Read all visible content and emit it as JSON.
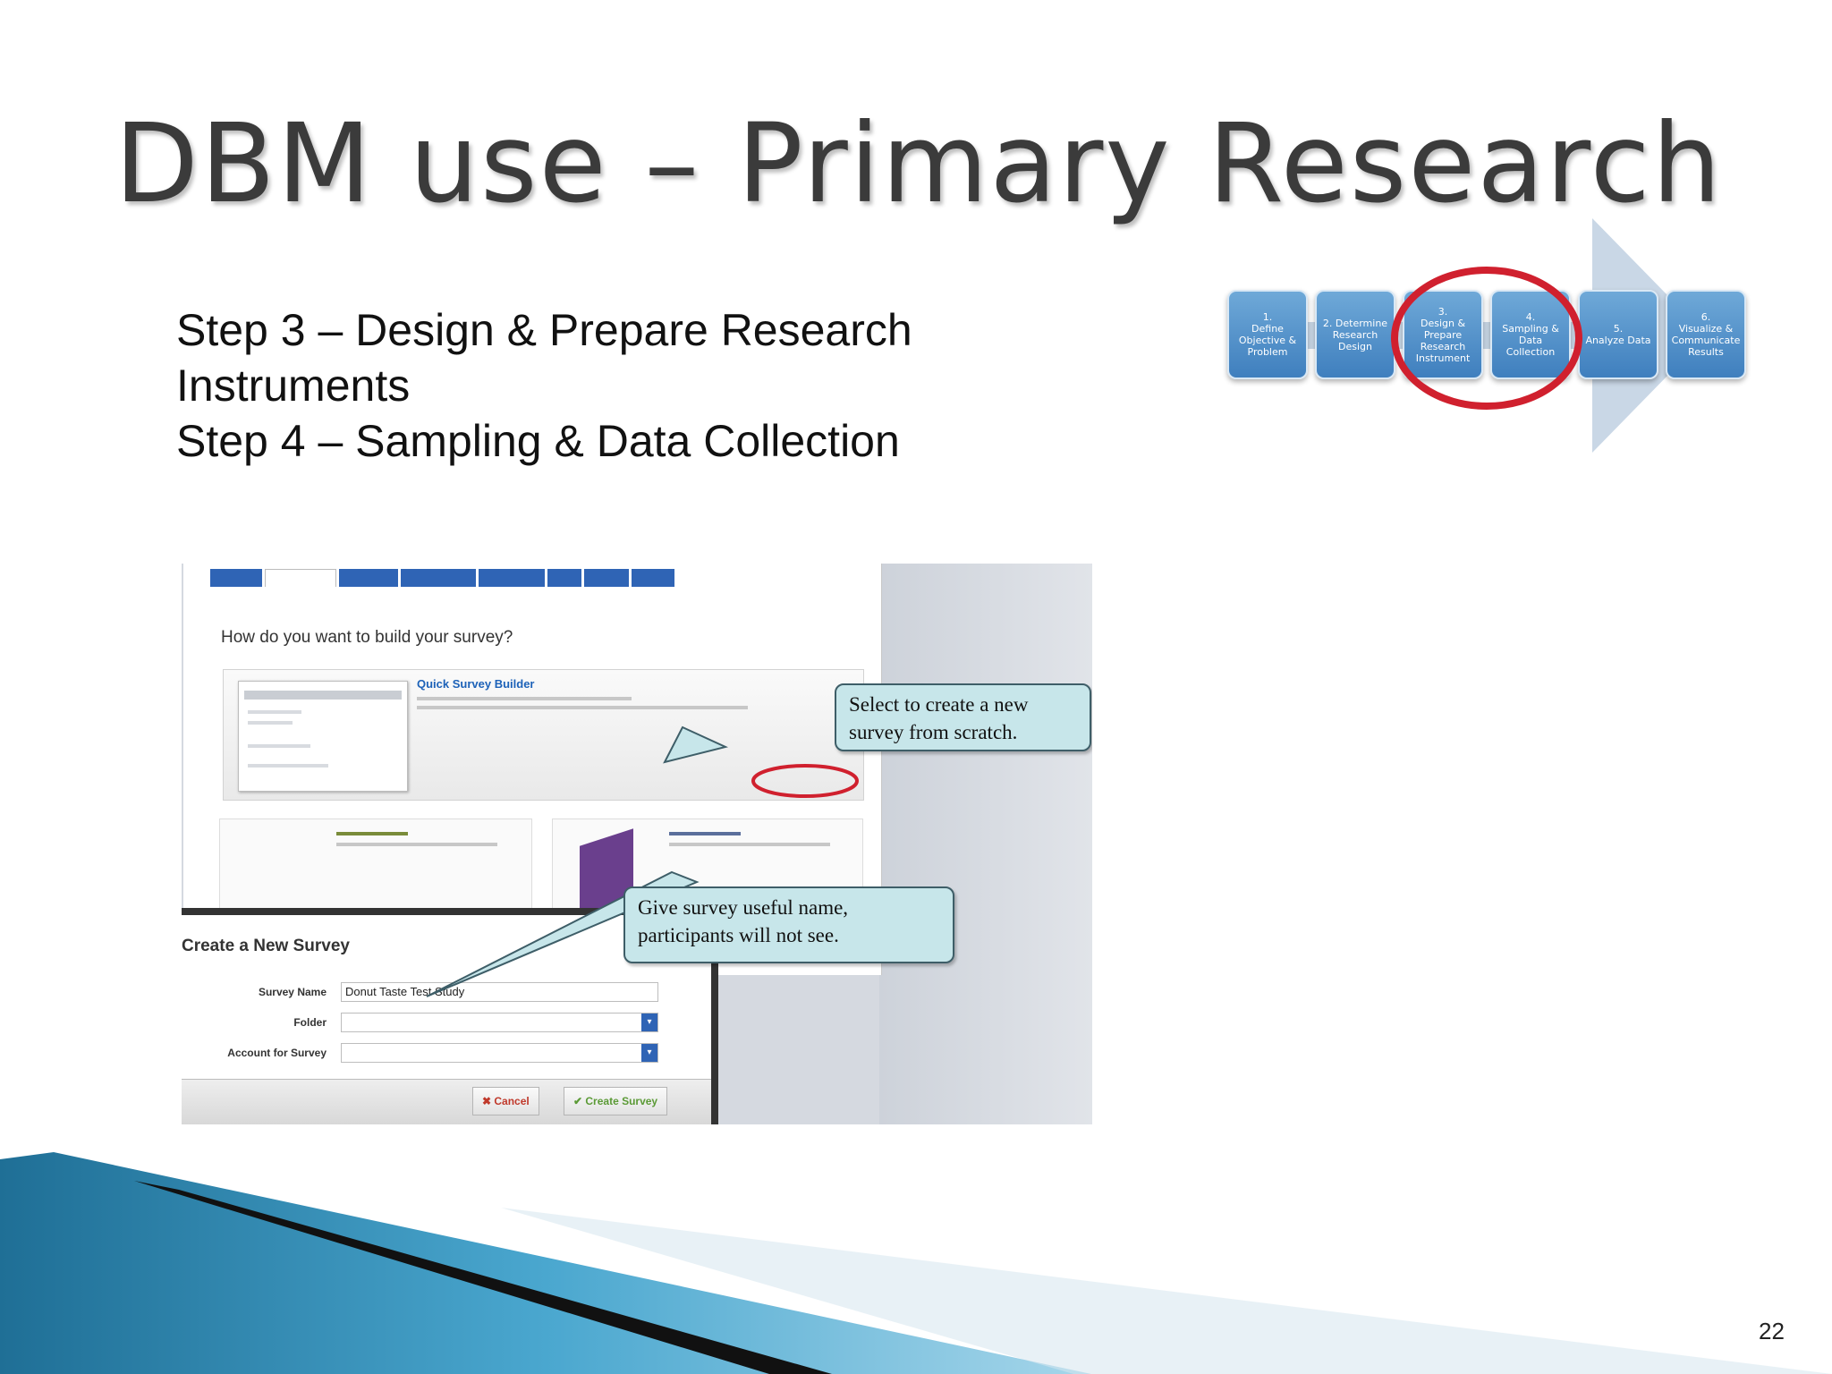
{
  "slide": {
    "title": "DBM use – Primary Research",
    "steps": [
      "Step 3 – Design & Prepare Research",
      "Instruments",
      "Step 4 – Sampling & Data Collection"
    ],
    "page_number": "22"
  },
  "process": {
    "steps": [
      "1.\nDefine\nObjective &\nProblem",
      "2. Determine\nResearch\nDesign",
      "3.\nDesign &\nPrepare\nResearch\nInstrument",
      "4.\nSampling &\nData\nCollection",
      "5.\nAnalyze Data",
      "6.\nVisualize &\nCommunicate\nResults"
    ],
    "highlighted_steps": [
      3,
      4
    ],
    "colors": {
      "box": "#4f8fcb",
      "arrow": "#c9d7e6",
      "highlight_ring": "#d0202e"
    }
  },
  "screenshot": {
    "question": "How do you want to build your survey?",
    "quick_builder_title": "Quick Survey Builder",
    "callout_1": "Select to create a new survey from scratch.",
    "callout_2": "Give survey useful name, participants will not see.",
    "dialog_title": "Create a New Survey",
    "fields": [
      {
        "label": "Survey Name",
        "value": "Donut Taste Test Study"
      },
      {
        "label": "Folder",
        "value": ""
      },
      {
        "label": "Account for Survey",
        "value": ""
      }
    ],
    "cancel_label": "Cancel",
    "create_label": "Create Survey"
  }
}
